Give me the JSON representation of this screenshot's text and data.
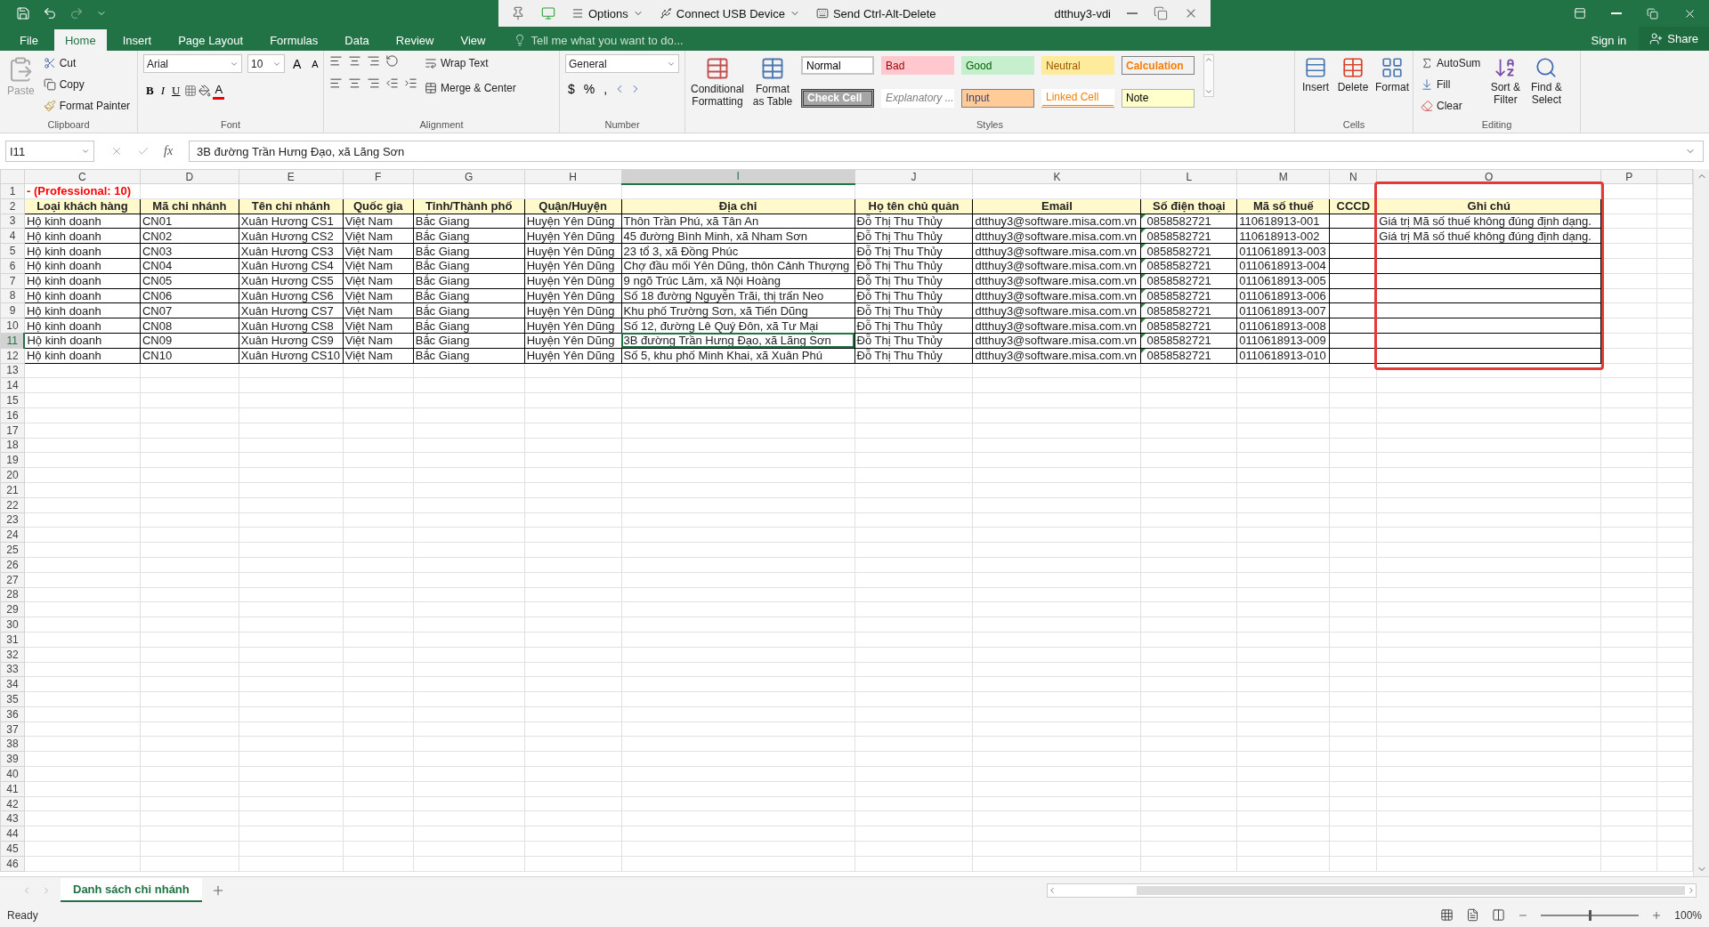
{
  "title_bar": {
    "remote_toolbar": {
      "items": [
        {
          "label": "Options"
        },
        {
          "label": "Connect USB Device"
        },
        {
          "label": "Send Ctrl-Alt-Delete"
        }
      ],
      "session": "dtthuy3-vdi"
    }
  },
  "menu": {
    "tabs": [
      {
        "label": "File",
        "selected": false
      },
      {
        "label": "Home",
        "selected": true
      },
      {
        "label": "Insert",
        "selected": false
      },
      {
        "label": "Page Layout",
        "selected": false
      },
      {
        "label": "Formulas",
        "selected": false
      },
      {
        "label": "Data",
        "selected": false
      },
      {
        "label": "Review",
        "selected": false
      },
      {
        "label": "View",
        "selected": false
      }
    ],
    "tell_me": "Tell me what you want to do...",
    "sign_in": "Sign in",
    "share": "Share"
  },
  "ribbon": {
    "clipboard": {
      "label": "Clipboard",
      "paste": "Paste",
      "cut": "Cut",
      "copy": "Copy",
      "format_painter": "Format Painter"
    },
    "font": {
      "label": "Font",
      "name": "Arial",
      "size": "10",
      "grow": "A",
      "shrink": "A",
      "bold": "B",
      "italic": "I",
      "underline": "U",
      "color_letter": "A"
    },
    "alignment": {
      "label": "Alignment",
      "wrap_text": "Wrap Text",
      "merge_center": "Merge & Center"
    },
    "number": {
      "label": "Number",
      "format": "General",
      "currency": "$",
      "percent": "%",
      "comma": ","
    },
    "styles": {
      "label": "Styles",
      "conditional": "Conditional Formatting",
      "format_table": "Format as Table",
      "cells": [
        {
          "label": "Normal",
          "kind": "normal"
        },
        {
          "label": "Bad",
          "kind": "bad"
        },
        {
          "label": "Good",
          "kind": "good"
        },
        {
          "label": "Neutral",
          "kind": "neutral"
        },
        {
          "label": "Calculation",
          "kind": "calculation"
        },
        {
          "label": "Check Cell",
          "kind": "check"
        },
        {
          "label": "Explanatory ...",
          "kind": "explanatory"
        },
        {
          "label": "Input",
          "kind": "input"
        },
        {
          "label": "Linked Cell",
          "kind": "linked"
        },
        {
          "label": "Note",
          "kind": "note"
        }
      ]
    },
    "cells": {
      "label": "Cells",
      "buttons": [
        "Insert",
        "Delete",
        "Format"
      ]
    },
    "editing": {
      "label": "Editing",
      "autosum": "AutoSum",
      "fill": "Fill",
      "clear": "Clear",
      "sort": "Sort & Filter",
      "find": "Find & Select"
    }
  },
  "formula_bar": {
    "name_box": "I11",
    "function_label": "fx",
    "formula": "3B đường Trần Hưng Đạo, xã Lãng Sơn"
  },
  "sheet": {
    "columns": [
      {
        "letter": "C",
        "selected": false,
        "kind": "plain"
      },
      {
        "letter": "D",
        "selected": false,
        "kind": "plain"
      },
      {
        "letter": "E",
        "selected": false,
        "kind": "plain"
      },
      {
        "letter": "F",
        "selected": false,
        "kind": "plain"
      },
      {
        "letter": "G",
        "selected": false,
        "kind": "plain"
      },
      {
        "letter": "H",
        "selected": false,
        "kind": "plain"
      },
      {
        "letter": "I",
        "selected": true,
        "kind": "plain"
      },
      {
        "letter": "J",
        "selected": false,
        "kind": "plain"
      },
      {
        "letter": "K",
        "selected": false,
        "kind": "plain"
      },
      {
        "letter": "L",
        "selected": false,
        "kind": "flagged"
      },
      {
        "letter": "M",
        "selected": false,
        "kind": "plain"
      },
      {
        "letter": "N",
        "selected": false,
        "kind": "plain"
      },
      {
        "letter": "O",
        "selected": false,
        "kind": "framed"
      },
      {
        "letter": "P",
        "selected": false,
        "kind": "plain"
      }
    ],
    "rows": [
      {
        "number": "1",
        "kind": "title",
        "selected": false,
        "cells": [
          "- (Professional: 10)"
        ]
      },
      {
        "number": "2",
        "kind": "header",
        "selected": false,
        "cells": [
          "Loại khách hàng",
          "Mã chi nhánh",
          "Tên chi nhánh",
          "Quốc gia",
          "Tỉnh/Thành phố",
          "Quận/Huyện",
          "Địa chỉ",
          "Họ tên chủ quản",
          "Email",
          "Số điện thoại",
          "Mã số thuế",
          "CCCD",
          "Ghi chú"
        ]
      },
      {
        "number": "3",
        "kind": "data",
        "selected": false,
        "cells": [
          "Hộ kinh doanh",
          "CN01",
          "Xuân Hương CS1",
          "Việt Nam",
          "Bắc Giang",
          "Huyện Yên Dũng",
          "Thôn Trần Phú, xã Tân An",
          "Đỗ Thị Thu Thủy",
          "dtthuy3@software.misa.com.vn",
          "0858582721",
          "110618913-001",
          null,
          "Giá trị Mã số thuế không đúng định dạng."
        ]
      },
      {
        "number": "4",
        "kind": "data",
        "selected": false,
        "cells": [
          "Hộ kinh doanh",
          "CN02",
          "Xuân Hương CS2",
          "Việt Nam",
          "Bắc Giang",
          "Huyện Yên Dũng",
          "45 đường Bình Minh, xã Nham Sơn",
          "Đỗ Thị Thu Thủy",
          "dtthuy3@software.misa.com.vn",
          "0858582721",
          "110618913-002",
          null,
          "Giá trị Mã số thuế không đúng định dạng."
        ]
      },
      {
        "number": "5",
        "kind": "data",
        "selected": false,
        "cells": [
          "Hộ kinh doanh",
          "CN03",
          "Xuân Hương CS3",
          "Việt Nam",
          "Bắc Giang",
          "Huyện Yên Dũng",
          "23 tổ 3, xã Đồng Phúc",
          "Đỗ Thị Thu Thủy",
          "dtthuy3@software.misa.com.vn",
          "0858582721",
          "0110618913-003",
          null,
          null
        ]
      },
      {
        "number": "6",
        "kind": "data",
        "selected": false,
        "cells": [
          "Hộ kinh doanh",
          "CN04",
          "Xuân Hương CS4",
          "Việt Nam",
          "Bắc Giang",
          "Huyện Yên Dũng",
          "Chợ đầu mối Yên Dũng, thôn Cảnh Thượng",
          "Đỗ Thị Thu Thủy",
          "dtthuy3@software.misa.com.vn",
          "0858582721",
          "0110618913-004",
          null,
          null
        ]
      },
      {
        "number": "7",
        "kind": "data",
        "selected": false,
        "cells": [
          "Hộ kinh doanh",
          "CN05",
          "Xuân Hương CS5",
          "Việt Nam",
          "Bắc Giang",
          "Huyện Yên Dũng",
          "9 ngõ Trúc Lâm, xã Nội Hoàng",
          "Đỗ Thị Thu Thủy",
          "dtthuy3@software.misa.com.vn",
          "0858582721",
          "0110618913-005",
          null,
          null
        ]
      },
      {
        "number": "8",
        "kind": "data",
        "selected": false,
        "cells": [
          "Hộ kinh doanh",
          "CN06",
          "Xuân Hương CS6",
          "Việt Nam",
          "Bắc Giang",
          "Huyện Yên Dũng",
          "Số 18 đường Nguyễn Trãi, thị trấn Neo",
          "Đỗ Thị Thu Thủy",
          "dtthuy3@software.misa.com.vn",
          "0858582721",
          "0110618913-006",
          null,
          null
        ]
      },
      {
        "number": "9",
        "kind": "data",
        "selected": false,
        "cells": [
          "Hộ kinh doanh",
          "CN07",
          "Xuân Hương CS7",
          "Việt Nam",
          "Bắc Giang",
          "Huyện Yên Dũng",
          "Khu phố Trường Sơn, xã Tiến Dũng",
          "Đỗ Thị Thu Thủy",
          "dtthuy3@software.misa.com.vn",
          "0858582721",
          "0110618913-007",
          null,
          null
        ]
      },
      {
        "number": "10",
        "kind": "data",
        "selected": false,
        "cells": [
          "Hộ kinh doanh",
          "CN08",
          "Xuân Hương CS8",
          "Việt Nam",
          "Bắc Giang",
          "Huyện Yên Dũng",
          "Số 12, đường Lê Quý Đôn, xã Tư Mại",
          "Đỗ Thị Thu Thủy",
          "dtthuy3@software.misa.com.vn",
          "0858582721",
          "0110618913-008",
          null,
          null
        ]
      },
      {
        "number": "11",
        "kind": "data",
        "selected": true,
        "cells": [
          "Hộ kinh doanh",
          "CN09",
          "Xuân Hương CS9",
          "Việt Nam",
          "Bắc Giang",
          "Huyện Yên Dũng",
          "3B đường Trần Hưng Đạo, xã Lãng Sơn",
          "Đỗ Thị Thu Thủy",
          "dtthuy3@software.misa.com.vn",
          "0858582721",
          "0110618913-009",
          null,
          null
        ]
      },
      {
        "number": "12",
        "kind": "data",
        "selected": false,
        "cells": [
          "Hộ kinh doanh",
          "CN10",
          "Xuân Hương CS10",
          "Việt Nam",
          "Bắc Giang",
          "Huyện Yên Dũng",
          " Số 5, khu phố Minh Khai, xã Xuân Phú",
          "Đỗ Thị Thu Thủy",
          "dtthuy3@software.misa.com.vn",
          "0858582721",
          "0110618913-010",
          null,
          null
        ]
      }
    ],
    "empty_rows": [
      "13",
      "14",
      "15",
      "16",
      "17",
      "18",
      "19",
      "20",
      "21",
      "22",
      "23",
      "24",
      "25",
      "26",
      "27",
      "28",
      "29",
      "30",
      "31",
      "32",
      "33",
      "34",
      "35",
      "36",
      "37",
      "38",
      "39",
      "40",
      "41",
      "42",
      "43",
      "44",
      "45",
      "46"
    ]
  },
  "sheet_tabs": [
    {
      "label": "Danh sách chi nhánh",
      "selected": true
    }
  ],
  "status_bar": {
    "status": "Ready",
    "zoom": "100%",
    "zoom_slider": {
      "level": 0.5
    }
  }
}
